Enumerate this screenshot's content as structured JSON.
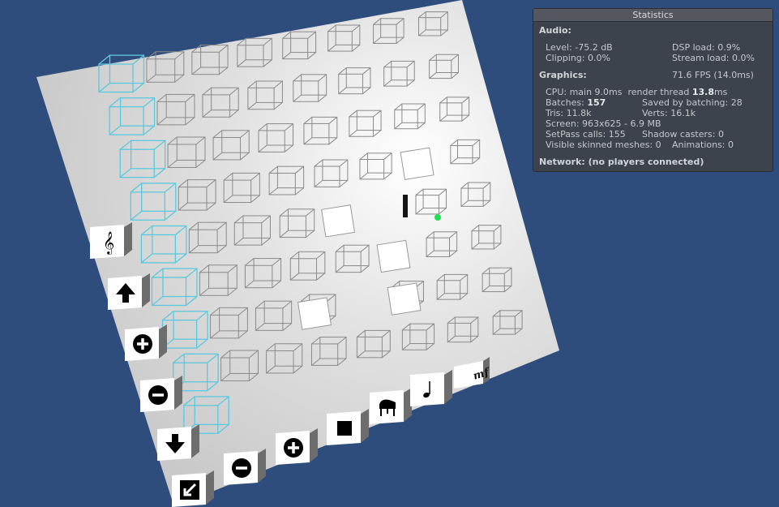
{
  "stats": {
    "title": "Statistics",
    "audio_header": "Audio:",
    "level": "Level: -75.2 dB",
    "dsp_load": "DSP load: 0.9%",
    "clipping": "Clipping: 0.0%",
    "stream_load": "Stream load: 0.0%",
    "graphics_header": "Graphics:",
    "fps": "71.6 FPS (14.0ms)",
    "cpu_prefix": "CPU: main 9.0ms  render thread ",
    "cpu_render": "13.8",
    "cpu_suffix": "ms",
    "batches_label": "Batches: ",
    "batches_value": "157",
    "saved_batching": "Saved by batching: 28",
    "tris": "Tris: 11.8k",
    "verts": "Verts: 16.1k",
    "screen": "Screen: 963x625 - 6.9 MB",
    "setpass": "SetPass calls: 155",
    "shadow_casters": "Shadow casters: 0",
    "skinned_meshes": "Visible skinned meshes: 0",
    "animations": "Animations: 0",
    "network": "Network: (no players connected)"
  },
  "scene": {
    "background_color": "#2f4d7c",
    "board_color": "#e6e6e6",
    "highlight_color": "#5cc8de",
    "cursor_color": "#22dd55",
    "left_column_icons": [
      "treble-clef-icon",
      "arrow-up-icon",
      "plus-icon",
      "minus-icon",
      "arrow-down-icon",
      "arrow-down-left-icon"
    ],
    "bottom_row_icons": [
      "arrow-down-left-icon",
      "minus-icon",
      "plus-icon",
      "stop-icon",
      "grand-piano-icon",
      "quarter-note-icon"
    ],
    "dynamic_marking": "mf"
  }
}
